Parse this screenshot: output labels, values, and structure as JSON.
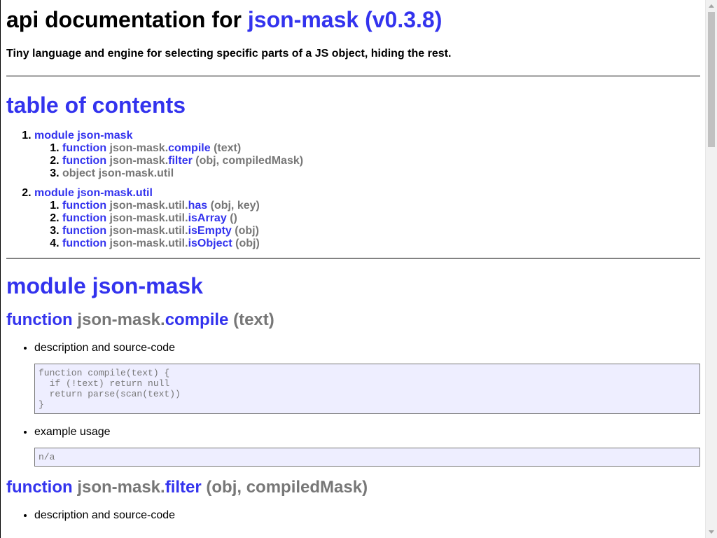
{
  "header": {
    "prefix": "api documentation for ",
    "package_link": "json-mask (v0.3.8)",
    "tagline": "Tiny language and engine for selecting specific parts of a JS object, hiding the rest."
  },
  "toc": {
    "title": "table of contents",
    "modules": [
      {
        "label": "module json-mask",
        "items": [
          {
            "kind": "function",
            "prefix": "json-mask.",
            "name": "compile",
            "args": "(text)"
          },
          {
            "kind": "function",
            "prefix": "json-mask.",
            "name": "filter",
            "args": "(obj, compiledMask)"
          },
          {
            "text": "object json-mask.util"
          }
        ]
      },
      {
        "label": "module json-mask.util",
        "items": [
          {
            "kind": "function",
            "prefix": "json-mask.util.",
            "name": "has",
            "args": "(obj, key)"
          },
          {
            "kind": "function",
            "prefix": "json-mask.util.",
            "name": "isArray",
            "args": "()"
          },
          {
            "kind": "function",
            "prefix": "json-mask.util.",
            "name": "isEmpty",
            "args": "(obj)"
          },
          {
            "kind": "function",
            "prefix": "json-mask.util.",
            "name": "isObject",
            "args": "(obj)"
          }
        ]
      }
    ]
  },
  "module_section": {
    "title": "module json-mask",
    "functions": [
      {
        "kind": "function",
        "prefix": "json-mask.",
        "name": "compile",
        "args": "(text)",
        "desc_label": "description and source-code",
        "code": "function compile(text) {\n  if (!text) return null\n  return parse(scan(text))\n}",
        "example_label": "example usage",
        "example": "n/a"
      },
      {
        "kind": "function",
        "prefix": "json-mask.",
        "name": "filter",
        "args": "(obj, compiledMask)",
        "desc_label": "description and source-code"
      }
    ]
  },
  "colors": {
    "link": "#3333ee",
    "muted": "#777777",
    "code_bg": "#eeeeff"
  },
  "scrollbar": {
    "position_fraction": 0.0
  }
}
